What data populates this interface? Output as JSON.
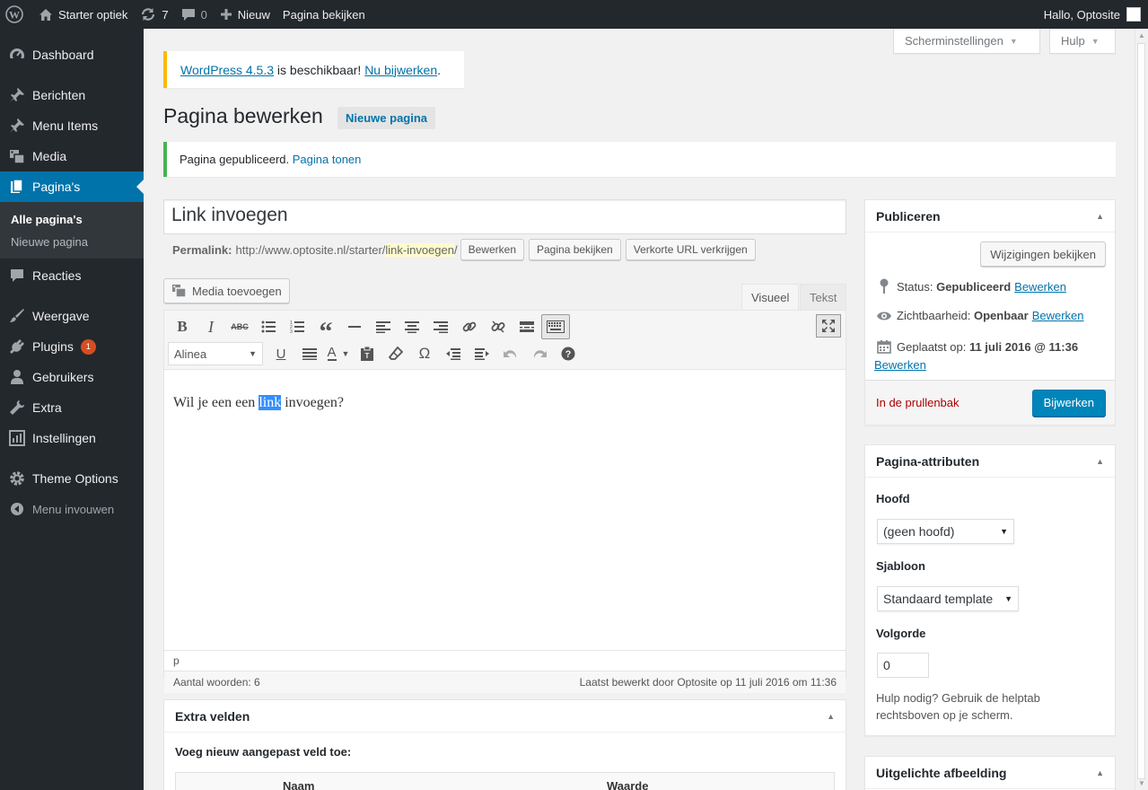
{
  "admin_bar": {
    "site_name": "Starter optiek",
    "updates_count": "7",
    "comments_count": "0",
    "new_label": "Nieuw",
    "view_page_label": "Pagina bekijken",
    "greeting": "Hallo, Optosite"
  },
  "sidebar": {
    "dashboard": "Dashboard",
    "posts": "Berichten",
    "menu_items": "Menu Items",
    "media": "Media",
    "pages": "Pagina's",
    "pages_sub_all": "Alle pagina's",
    "pages_sub_new": "Nieuwe pagina",
    "comments": "Reacties",
    "appearance": "Weergave",
    "plugins": "Plugins",
    "plugins_badge": "1",
    "users": "Gebruikers",
    "tools": "Extra",
    "settings": "Instellingen",
    "theme_options": "Theme Options",
    "collapse": "Menu invouwen"
  },
  "screen_meta": {
    "screen_options": "Scherminstellingen",
    "help": "Hulp"
  },
  "notices": {
    "update_link": "WordPress 4.5.3",
    "update_text": " is beschikbaar! ",
    "update_now": "Nu bijwerken",
    "update_end": ".",
    "published_text": "Pagina gepubliceerd. ",
    "published_link": "Pagina tonen"
  },
  "page": {
    "title": "Pagina bewerken",
    "add_new": "Nieuwe pagina"
  },
  "editor": {
    "post_title": "Link invoegen",
    "permalink_label": "Permalink:",
    "permalink_base": "http://www.optosite.nl/starter/",
    "permalink_slug": "link-invoegen",
    "permalink_end": "/",
    "edit_btn": "Bewerken",
    "view_btn": "Pagina bekijken",
    "shortlink_btn": "Verkorte URL verkrijgen",
    "media_btn": "Media toevoegen",
    "tab_visual": "Visueel",
    "tab_text": "Tekst",
    "format_value": "Alinea",
    "content_before": "Wil je een een ",
    "content_selected": "link",
    "content_after": " invoegen?",
    "path": "p",
    "word_count": "Aantal woorden: 6",
    "last_edited": "Laatst bewerkt door Optosite op 11 juli 2016 om 11:36"
  },
  "publish": {
    "title": "Publiceren",
    "preview_btn": "Wijzigingen bekijken",
    "status_label": "Status: ",
    "status_value": "Gepubliceerd",
    "status_edit": "Bewerken",
    "visibility_label": "Zichtbaarheid: ",
    "visibility_value": "Openbaar",
    "visibility_edit": "Bewerken",
    "date_label": "Geplaatst op: ",
    "date_value": "11 juli 2016 @ 11:36",
    "date_edit": "Bewerken",
    "trash": "In de prullenbak",
    "update_btn": "Bijwerken"
  },
  "attributes": {
    "title": "Pagina-attributen",
    "parent_label": "Hoofd",
    "parent_value": "(geen hoofd)",
    "template_label": "Sjabloon",
    "template_value": "Standaard template",
    "order_label": "Volgorde",
    "order_value": "0",
    "help": "Hulp nodig? Gebruik de helptab rechtsboven op je scherm."
  },
  "custom_fields": {
    "title": "Extra velden",
    "add_label": "Voeg nieuw aangepast veld toe:",
    "col_name": "Naam",
    "col_value": "Waarde"
  },
  "featured": {
    "title": "Uitgelichte afbeelding"
  }
}
